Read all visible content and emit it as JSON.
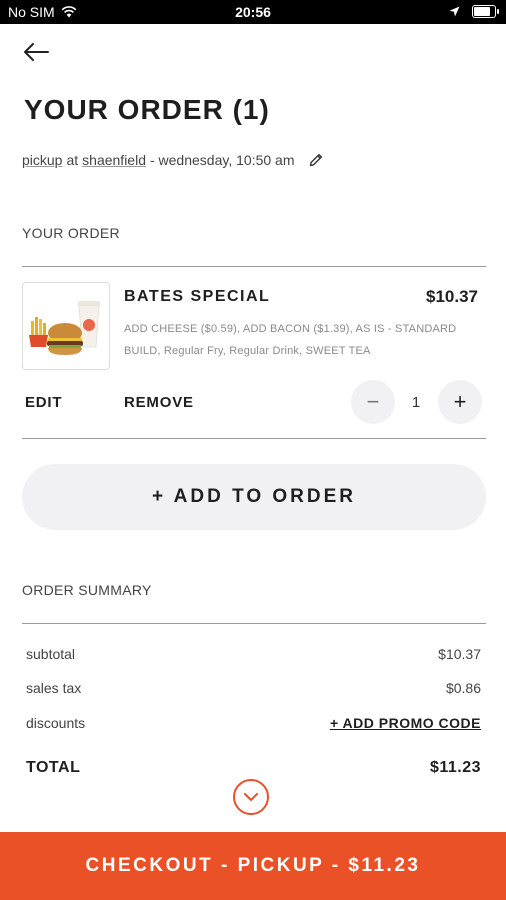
{
  "status_bar": {
    "carrier": "No SIM",
    "time": "20:56"
  },
  "header": {
    "title": "YOUR ORDER (1)",
    "order_type": "pickup",
    "at_word": "at",
    "location": "shaenfield",
    "datetime": "- wednesday, 10:50 am"
  },
  "order": {
    "section_label": "YOUR ORDER",
    "item": {
      "name": "BATES SPECIAL",
      "price": "$10.37",
      "desc_line1": "ADD CHEESE ($0.59), ADD BACON ($1.39), AS IS - STANDARD",
      "desc_line2": "BUILD, Regular Fry, Regular Drink, SWEET TEA",
      "edit_label": "EDIT",
      "remove_label": "REMOVE",
      "quantity": "1",
      "decrement_symbol": "−",
      "increment_symbol": "+"
    },
    "add_button_label": "+ ADD TO ORDER"
  },
  "summary": {
    "section_label": "ORDER SUMMARY",
    "subtotal_label": "subtotal",
    "subtotal_value": "$10.37",
    "tax_label": "sales tax",
    "tax_value": "$0.86",
    "discounts_label": "discounts",
    "promo_label": "+ ADD PROMO CODE",
    "total_label": "TOTAL",
    "total_value": "$11.23"
  },
  "checkout": {
    "label": "CHECKOUT - PICKUP - $11.23"
  },
  "colors": {
    "accent": "#eb5127",
    "button_bg": "#f1f1f4"
  },
  "icons": [
    "back-arrow-icon",
    "pencil-icon",
    "minus-icon",
    "plus-icon",
    "chevron-down-icon",
    "wifi-icon",
    "location-arrow-icon",
    "battery-icon"
  ]
}
